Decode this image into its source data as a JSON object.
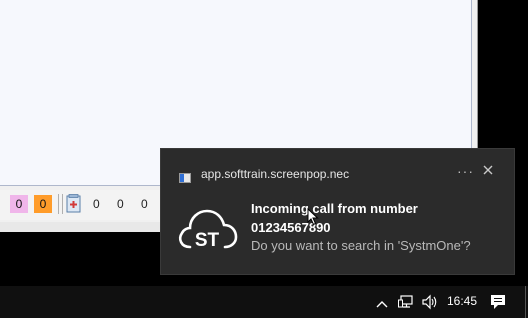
{
  "app": {
    "status_badges": [
      {
        "value": "0",
        "color": "#f0b6ea"
      },
      {
        "value": "0",
        "color": "#ff9c2a"
      }
    ],
    "counters": [
      "0",
      "0",
      "0"
    ]
  },
  "toast": {
    "app_name": "app.softtrain.screenpop.nec",
    "more_label": "···",
    "logo_text": "ST",
    "title": "Incoming call from number",
    "number": "01234567890",
    "question": "Do you want to search in 'SystmOne'?"
  },
  "taskbar": {
    "clock": "16:45",
    "icons": [
      "chevron-up-icon",
      "network-icon",
      "volume-icon",
      "action-center-icon"
    ]
  },
  "colors": {
    "toast_bg": "#2b2b2b",
    "taskbar_bg": "#101010",
    "accent_blue": "#2f6fd6"
  }
}
